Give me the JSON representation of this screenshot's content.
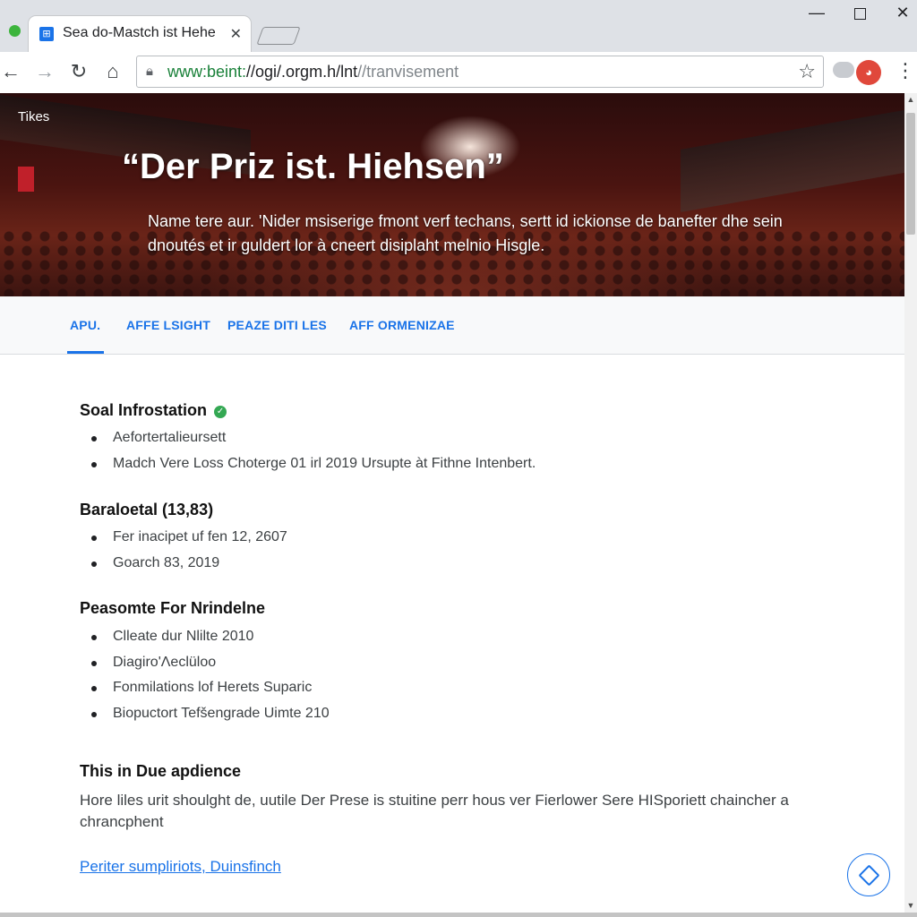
{
  "browser": {
    "tab_title": "Sea do-Mastch ist Hehe",
    "tab_close": "✕",
    "url_host": "www:beint:",
    "url_domain": "//ogi/.orgm.h/lnt",
    "url_path": "//tranvisement",
    "window_min": "—",
    "window_close": "✕"
  },
  "hero": {
    "tag": "Tikes",
    "title": "“Der Priz ist. Hiehsen”",
    "subtitle": "Name tere aur. 'Nider msiserige fmont verf techans, sertt id ickionse de banefter dhe sein dnoutés et ir guldert lor à cneert disiplaht melnio Hisgle."
  },
  "page_tabs": [
    "APU.",
    "AFFE LSIGHT",
    "PEAZE DITI LES",
    "AFF ORMENIZAE"
  ],
  "sections": [
    {
      "heading": "Soal Infrostation",
      "items": [
        "Aefortertalieursett",
        "Madch Vere Loss Choterge 01 irl 2019 Ursupte àt Fithne Intenbert."
      ]
    },
    {
      "heading": "Baraloetal (13,83)",
      "items": [
        "Fer inacipet uf fen 12, 2607",
        "Goarch 83, 2019"
      ]
    },
    {
      "heading": "Peasomte For Nrindelne",
      "items": [
        "Clleate dur Nlilte 2010",
        "Diagiro'Ʌeclüloo",
        "Fonmilations lof Herets Suparic",
        "Biopuctort Tefšengrade Uimte 210"
      ]
    }
  ],
  "audience": {
    "heading": "This in Due apdience",
    "paragraph": "Hore liles urit shoulght de, uutile Der Prese is stuitine perr hous ver Fierlower Sere HISporiett chaincher a chrancphent",
    "link": "Periter sumpliriots, Duinsfinch"
  }
}
